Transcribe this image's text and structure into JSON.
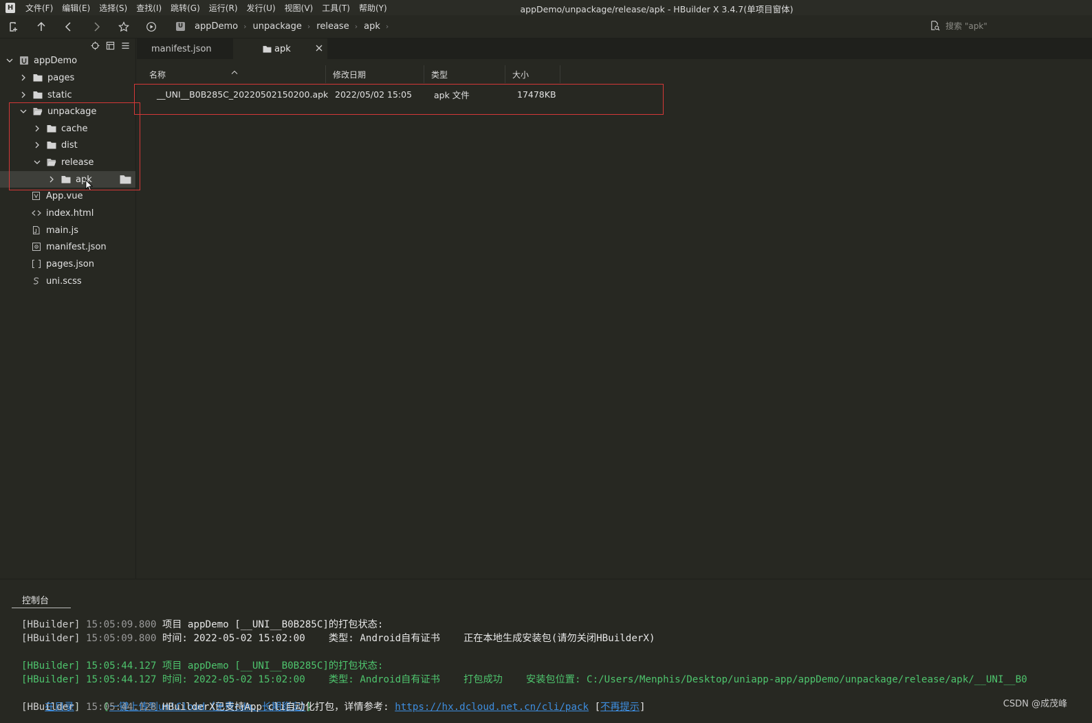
{
  "window": {
    "logo": "H",
    "title": "appDemo/unpackage/release/apk - HBuilder X 3.4.7(单项目窗体)"
  },
  "menu": [
    "文件(F)",
    "编辑(E)",
    "选择(S)",
    "查找(I)",
    "跳转(G)",
    "运行(R)",
    "发行(U)",
    "视图(V)",
    "工具(T)",
    "帮助(Y)"
  ],
  "toolbar": {
    "breadcrumb": [
      "appDemo",
      "unpackage",
      "release",
      "apk"
    ],
    "breadcrumb_logo": "U",
    "search_placeholder": "搜索 \"apk\""
  },
  "sidebar": {
    "items": [
      {
        "label": "appDemo",
        "icon": "project-icon",
        "expanded": true
      },
      {
        "label": "pages",
        "icon": "folder-icon",
        "expanded": false
      },
      {
        "label": "static",
        "icon": "folder-icon",
        "expanded": false
      },
      {
        "label": "unpackage",
        "icon": "folder-open-icon",
        "expanded": true
      },
      {
        "label": "cache",
        "icon": "folder-icon",
        "expanded": false
      },
      {
        "label": "dist",
        "icon": "folder-icon",
        "expanded": false
      },
      {
        "label": "release",
        "icon": "folder-open-icon",
        "expanded": true
      },
      {
        "label": "apk",
        "icon": "folder-icon",
        "expanded": false,
        "selected": true
      },
      {
        "label": "App.vue",
        "icon": "vue-file-icon"
      },
      {
        "label": "index.html",
        "icon": "html-file-icon"
      },
      {
        "label": "main.js",
        "icon": "js-file-icon"
      },
      {
        "label": "manifest.json",
        "icon": "manifest-file-icon"
      },
      {
        "label": "pages.json",
        "icon": "json-file-icon"
      },
      {
        "label": "uni.scss",
        "icon": "scss-file-icon"
      }
    ]
  },
  "tabs": [
    {
      "label": "manifest.json",
      "active": false
    },
    {
      "label": "apk",
      "active": true
    }
  ],
  "filelist": {
    "columns": [
      "名称",
      "修改日期",
      "类型",
      "大小"
    ],
    "rows": [
      {
        "name": "__UNI__B0B285C_20220502150200.apk",
        "date": "2022/05/02 15:05",
        "type": "apk 文件",
        "size": "17478KB"
      }
    ]
  },
  "console": {
    "tab_label": "控制台",
    "lines": {
      "l1": {
        "tag": "[HBuilder]",
        "time": "15:05:09.800",
        "text": "项目 appDemo [__UNI__B0B285C]的打包状态:"
      },
      "l2": {
        "tag": "[HBuilder]",
        "time": "15:05:09.800",
        "text": "时间: 2022-05-02 15:02:00    类型: Android自有证书    正在本地生成安装包(请勿关闭HBuilderX)"
      },
      "l3": {
        "tag": "[HBuilder]",
        "time": "15:05:44.127",
        "text": "项目 appDemo [__UNI__B0B285C]的打包状态:"
      },
      "l4": {
        "tag": "[HBuilder]",
        "time": "15:05:44.127",
        "text": "时间: 2022-05-02 15:02:00    类型: Android自有证书    打包成功    安装包位置: C:/Users/Menphis/Desktop/uniapp-app/appDemo/unpackage/release/apk/__UNI__B0"
      },
      "l5": {
        "link1": "在目录",
        "bracket1": "]",
        "bracket2": "[",
        "link2": "一键上传到uniCloud（免费cdn、长期稳定）",
        "bracket3": "]"
      },
      "l6": {
        "tag": "[HBuilder]",
        "time": "15:05:44.128",
        "text": "HBuilderX已支持App cli自动化打包，详情参考: ",
        "link": "https://hx.dcloud.net.cn/cli/pack",
        "open": "[",
        "link2": "不再提示",
        "close": "]"
      }
    }
  },
  "watermark": "CSDN @成茂峰",
  "colors": {
    "background": "#272822",
    "highlight": "#d63838",
    "success": "#4ec46d",
    "link": "#3e8ee0"
  }
}
